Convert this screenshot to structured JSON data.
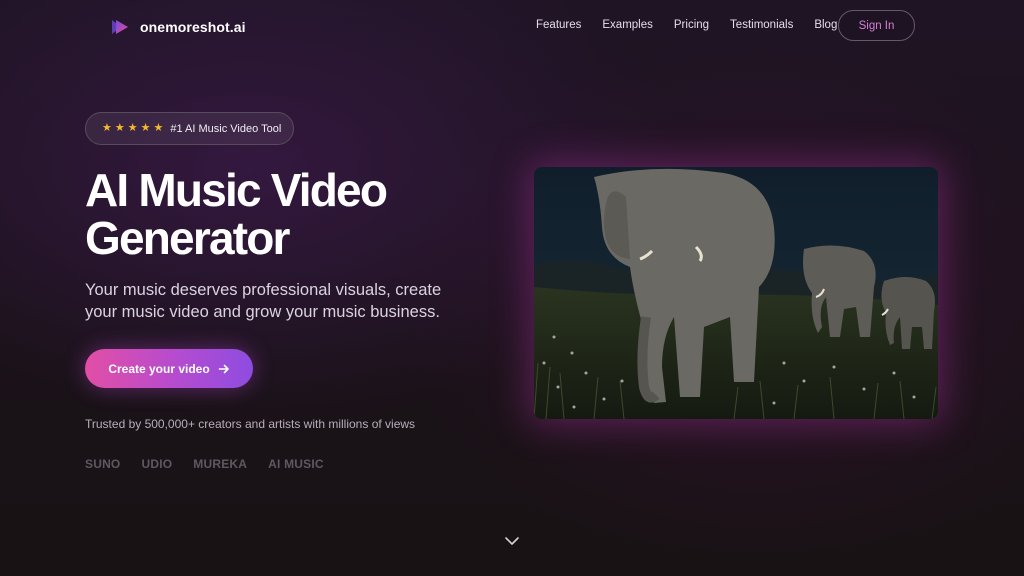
{
  "header": {
    "brand": "onemoreshot.ai",
    "links": [
      "Features",
      "Examples",
      "Pricing",
      "Testimonials",
      "Blog"
    ],
    "signin_label": "Sign In"
  },
  "hero": {
    "badge_text": "#1 AI Music Video Tool",
    "badge_stars": 5,
    "title_line1": "AI Music Video",
    "title_line2": "Generator",
    "subtitle": "Your music deserves professional visuals, create your music video and grow your music business.",
    "cta_label": "Create your video",
    "cta_icon": "arrow-right-icon",
    "trusted_text": "Trusted by 500,000+ creators and artists with millions of views",
    "partners": [
      "SUNO",
      "UDIO",
      "MUREKA",
      "AI MUSIC"
    ]
  },
  "media": {
    "subject": "elephants-at-night"
  },
  "colors": {
    "accent": "#d77fd6",
    "cta_start": "#e24ea5",
    "cta_end": "#8e4ce0",
    "star": "#f5b82e"
  }
}
